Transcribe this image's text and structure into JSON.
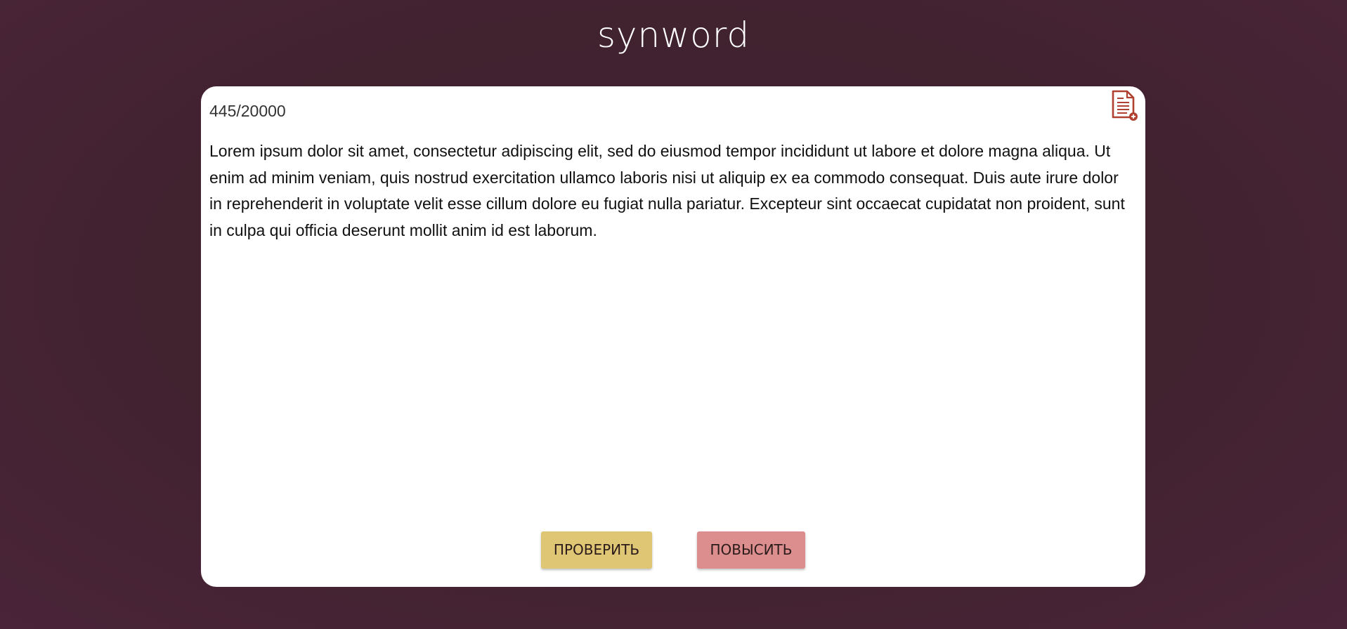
{
  "header": {
    "logo_text": "synword"
  },
  "editor": {
    "char_counter": "445/20000",
    "text": "Lorem ipsum dolor sit amet, consectetur adipiscing elit, sed do eiusmod tempor incididunt ut labore et dolore magna aliqua. Ut enim ad minim veniam, quis nostrud exercitation ullamco laboris nisi ut aliquip ex ea commodo consequat. Duis aute irure dolor in reprehenderit in voluptate velit esse cillum dolore eu fugiat nulla pariatur. Excepteur sint occaecat cupidatat non proident, sunt in culpa qui officia deserunt mollit anim id est laborum.",
    "icon": "add-document-icon"
  },
  "actions": {
    "check_label": "ПРОВЕРИТЬ",
    "boost_label": "ПОВЫСИТЬ"
  },
  "colors": {
    "background": "#41222f",
    "check_button": "#dfc674",
    "boost_button": "#db8e8d",
    "icon": "#b0402f"
  }
}
